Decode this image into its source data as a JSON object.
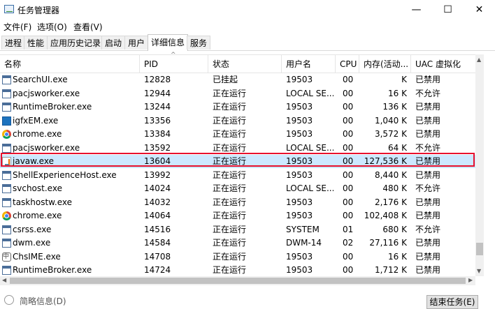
{
  "window": {
    "title": "任务管理器",
    "minimize": "—",
    "maximize": "☐",
    "close": "✕"
  },
  "menu": [
    "文件(F)",
    "选项(O)",
    "查看(V)"
  ],
  "tabs": [
    "进程",
    "性能",
    "应用历史记录",
    "启动",
    "用户",
    "详细信息",
    "服务"
  ],
  "active_tab": "详细信息",
  "columns": {
    "name": "名称",
    "pid": "PID",
    "status": "状态",
    "user": "用户名",
    "cpu": "CPU",
    "mem": "内存(活动...",
    "uac": "UAC 虚拟化"
  },
  "rows": [
    {
      "icon": "window-icon",
      "name": "SearchUI.exe",
      "pid": "12828",
      "status": "已挂起",
      "user": "19503",
      "cpu": "00",
      "mem": "K",
      "uac": "已禁用"
    },
    {
      "icon": "window-icon",
      "name": "pacjsworker.exe",
      "pid": "12944",
      "status": "正在运行",
      "user": "LOCAL SE...",
      "cpu": "00",
      "mem": "16 K",
      "uac": "不允许"
    },
    {
      "icon": "window-icon",
      "name": "RuntimeBroker.exe",
      "pid": "13244",
      "status": "正在运行",
      "user": "19503",
      "cpu": "00",
      "mem": "136 K",
      "uac": "已禁用"
    },
    {
      "icon": "igfx-icon",
      "name": "igfxEM.exe",
      "pid": "13356",
      "status": "正在运行",
      "user": "19503",
      "cpu": "00",
      "mem": "1,040 K",
      "uac": "已禁用"
    },
    {
      "icon": "chrome-icon",
      "name": "chrome.exe",
      "pid": "13384",
      "status": "正在运行",
      "user": "19503",
      "cpu": "00",
      "mem": "3,572 K",
      "uac": "已禁用"
    },
    {
      "icon": "window-icon",
      "name": "pacjsworker.exe",
      "pid": "13592",
      "status": "正在运行",
      "user": "LOCAL SE...",
      "cpu": "00",
      "mem": "64 K",
      "uac": "不允许"
    },
    {
      "icon": "java-icon",
      "name": "javaw.exe",
      "pid": "13604",
      "status": "正在运行",
      "user": "19503",
      "cpu": "00",
      "mem": "127,536 K",
      "uac": "已禁用"
    },
    {
      "icon": "window-icon",
      "name": "ShellExperienceHost.exe",
      "pid": "13992",
      "status": "正在运行",
      "user": "19503",
      "cpu": "00",
      "mem": "8,440 K",
      "uac": "已禁用"
    },
    {
      "icon": "window-icon",
      "name": "svchost.exe",
      "pid": "14024",
      "status": "正在运行",
      "user": "LOCAL SE...",
      "cpu": "00",
      "mem": "480 K",
      "uac": "不允许"
    },
    {
      "icon": "window-icon",
      "name": "taskhostw.exe",
      "pid": "14032",
      "status": "正在运行",
      "user": "19503",
      "cpu": "00",
      "mem": "2,176 K",
      "uac": "已禁用"
    },
    {
      "icon": "chrome-icon",
      "name": "chrome.exe",
      "pid": "14064",
      "status": "正在运行",
      "user": "19503",
      "cpu": "00",
      "mem": "102,408 K",
      "uac": "已禁用"
    },
    {
      "icon": "window-icon",
      "name": "csrss.exe",
      "pid": "14516",
      "status": "正在运行",
      "user": "SYSTEM",
      "cpu": "01",
      "mem": "680 K",
      "uac": "不允许"
    },
    {
      "icon": "window-icon",
      "name": "dwm.exe",
      "pid": "14584",
      "status": "正在运行",
      "user": "DWM-14",
      "cpu": "02",
      "mem": "27,116 K",
      "uac": "已禁用"
    },
    {
      "icon": "ime-icon",
      "name": "ChsIME.exe",
      "pid": "14708",
      "status": "正在运行",
      "user": "19503",
      "cpu": "00",
      "mem": "16 K",
      "uac": "已禁用"
    },
    {
      "icon": "window-icon",
      "name": "RuntimeBroker.exe",
      "pid": "14724",
      "status": "正在运行",
      "user": "19503",
      "cpu": "00",
      "mem": "1,712 K",
      "uac": "已禁用"
    }
  ],
  "selected_row": 6,
  "highlight_color": "#e8112d",
  "selection_color": "#cce8ff",
  "footer": {
    "detail_text": "简略信息(D)",
    "end_task": "结束任务(E)"
  }
}
